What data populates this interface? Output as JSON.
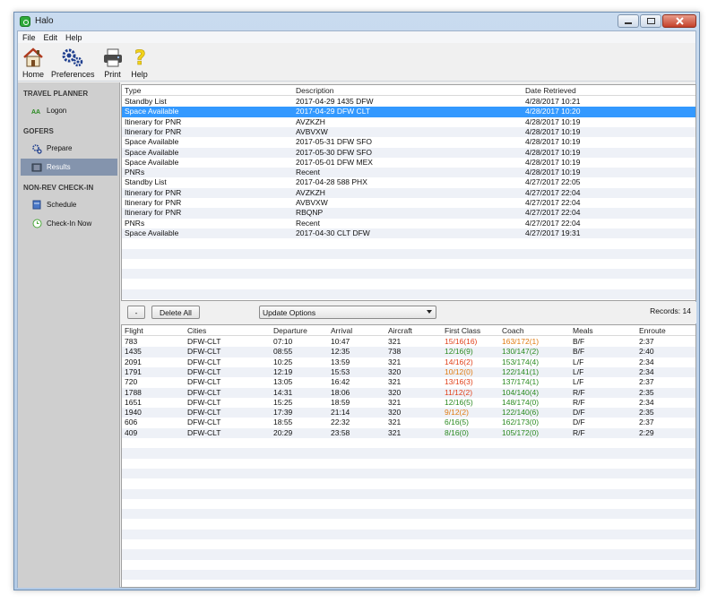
{
  "window": {
    "title": "Halo"
  },
  "menu": [
    "File",
    "Edit",
    "Help"
  ],
  "toolbar": [
    {
      "label": "Home",
      "icon": "home-icon"
    },
    {
      "label": "Preferences",
      "icon": "gears-icon"
    },
    {
      "label": "Print",
      "icon": "printer-icon"
    },
    {
      "label": "Help",
      "icon": "question-icon"
    }
  ],
  "sidebar": {
    "sections": [
      {
        "title": "TRAVEL PLANNER",
        "items": [
          {
            "label": "Logon",
            "icon": "aa-logo-icon"
          }
        ]
      },
      {
        "title": "GOFERS",
        "items": [
          {
            "label": "Prepare",
            "icon": "gears-icon"
          },
          {
            "label": "Results",
            "icon": "list-icon",
            "active": true
          }
        ]
      },
      {
        "title": "NON-REV CHECK-IN",
        "items": [
          {
            "label": "Schedule",
            "icon": "calendar-icon"
          },
          {
            "label": "Check-In Now",
            "icon": "clock-icon"
          }
        ]
      }
    ]
  },
  "results": {
    "columns": [
      "Type",
      "Description",
      "Date Retrieved"
    ],
    "selected_index": 1,
    "rows": [
      [
        "Standby List",
        "2017-04-29 1435 DFW",
        "4/28/2017 10:21"
      ],
      [
        "Space Available",
        "2017-04-29 DFW CLT",
        "4/28/2017 10:20"
      ],
      [
        "Itinerary for PNR",
        "AVZKZH",
        "4/28/2017 10:19"
      ],
      [
        "Itinerary for PNR",
        "AVBVXW",
        "4/28/2017 10:19"
      ],
      [
        "Space Available",
        "2017-05-31 DFW SFO",
        "4/28/2017 10:19"
      ],
      [
        "Space Available",
        "2017-05-30 DFW SFO",
        "4/28/2017 10:19"
      ],
      [
        "Space Available",
        "2017-05-01 DFW MEX",
        "4/28/2017 10:19"
      ],
      [
        "PNRs",
        "Recent",
        "4/28/2017 10:19"
      ],
      [
        "Standby List",
        "2017-04-28 588 PHX",
        "4/27/2017 22:05"
      ],
      [
        "Itinerary for PNR",
        "AVZKZH",
        "4/27/2017 22:04"
      ],
      [
        "Itinerary for PNR",
        "AVBVXW",
        "4/27/2017 22:04"
      ],
      [
        "Itinerary for PNR",
        "RBQNP",
        "4/27/2017 22:04"
      ],
      [
        "PNRs",
        "Recent",
        "4/27/2017 22:04"
      ],
      [
        "Space Available",
        "2017-04-30 CLT DFW",
        "4/27/2017 19:31"
      ]
    ]
  },
  "actions": {
    "minus_label": "-",
    "delete_all_label": "Delete All",
    "update_options_label": "Update Options",
    "records_label": "Records: 14"
  },
  "flights": {
    "columns": [
      "Flight",
      "Cities",
      "Departure",
      "Arrival",
      "Aircraft",
      "First Class",
      "Coach",
      "Meals",
      "Enroute"
    ],
    "colors": {
      "red": "#e0401a",
      "orange": "#e07a10",
      "green": "#2a8a20"
    },
    "rows": [
      {
        "cells": [
          "783",
          "DFW-CLT",
          "07:10",
          "10:47",
          "321",
          "15/16(16)",
          "163/172(1)",
          "B/F",
          "2:37"
        ],
        "fc": "red",
        "co": "orange"
      },
      {
        "cells": [
          "1435",
          "DFW-CLT",
          "08:55",
          "12:35",
          "738",
          "12/16(9)",
          "130/147(2)",
          "B/F",
          "2:40"
        ],
        "fc": "green",
        "co": "green"
      },
      {
        "cells": [
          "2091",
          "DFW-CLT",
          "10:25",
          "13:59",
          "321",
          "14/16(2)",
          "153/174(4)",
          "L/F",
          "2:34"
        ],
        "fc": "red",
        "co": "green"
      },
      {
        "cells": [
          "1791",
          "DFW-CLT",
          "12:19",
          "15:53",
          "320",
          "10/12(0)",
          "122/141(1)",
          "L/F",
          "2:34"
        ],
        "fc": "orange",
        "co": "green"
      },
      {
        "cells": [
          "720",
          "DFW-CLT",
          "13:05",
          "16:42",
          "321",
          "13/16(3)",
          "137/174(1)",
          "L/F",
          "2:37"
        ],
        "fc": "red",
        "co": "green"
      },
      {
        "cells": [
          "1788",
          "DFW-CLT",
          "14:31",
          "18:06",
          "320",
          "11/12(2)",
          "104/140(4)",
          "R/F",
          "2:35"
        ],
        "fc": "red",
        "co": "green"
      },
      {
        "cells": [
          "1651",
          "DFW-CLT",
          "15:25",
          "18:59",
          "321",
          "12/16(5)",
          "148/174(0)",
          "R/F",
          "2:34"
        ],
        "fc": "green",
        "co": "green"
      },
      {
        "cells": [
          "1940",
          "DFW-CLT",
          "17:39",
          "21:14",
          "320",
          "9/12(2)",
          "122/140(6)",
          "D/F",
          "2:35"
        ],
        "fc": "orange",
        "co": "green"
      },
      {
        "cells": [
          "606",
          "DFW-CLT",
          "18:55",
          "22:32",
          "321",
          "6/16(5)",
          "162/173(0)",
          "D/F",
          "2:37"
        ],
        "fc": "green",
        "co": "green"
      },
      {
        "cells": [
          "409",
          "DFW-CLT",
          "20:29",
          "23:58",
          "321",
          "8/16(0)",
          "105/172(0)",
          "R/F",
          "2:29"
        ],
        "fc": "green",
        "co": "green"
      }
    ]
  }
}
